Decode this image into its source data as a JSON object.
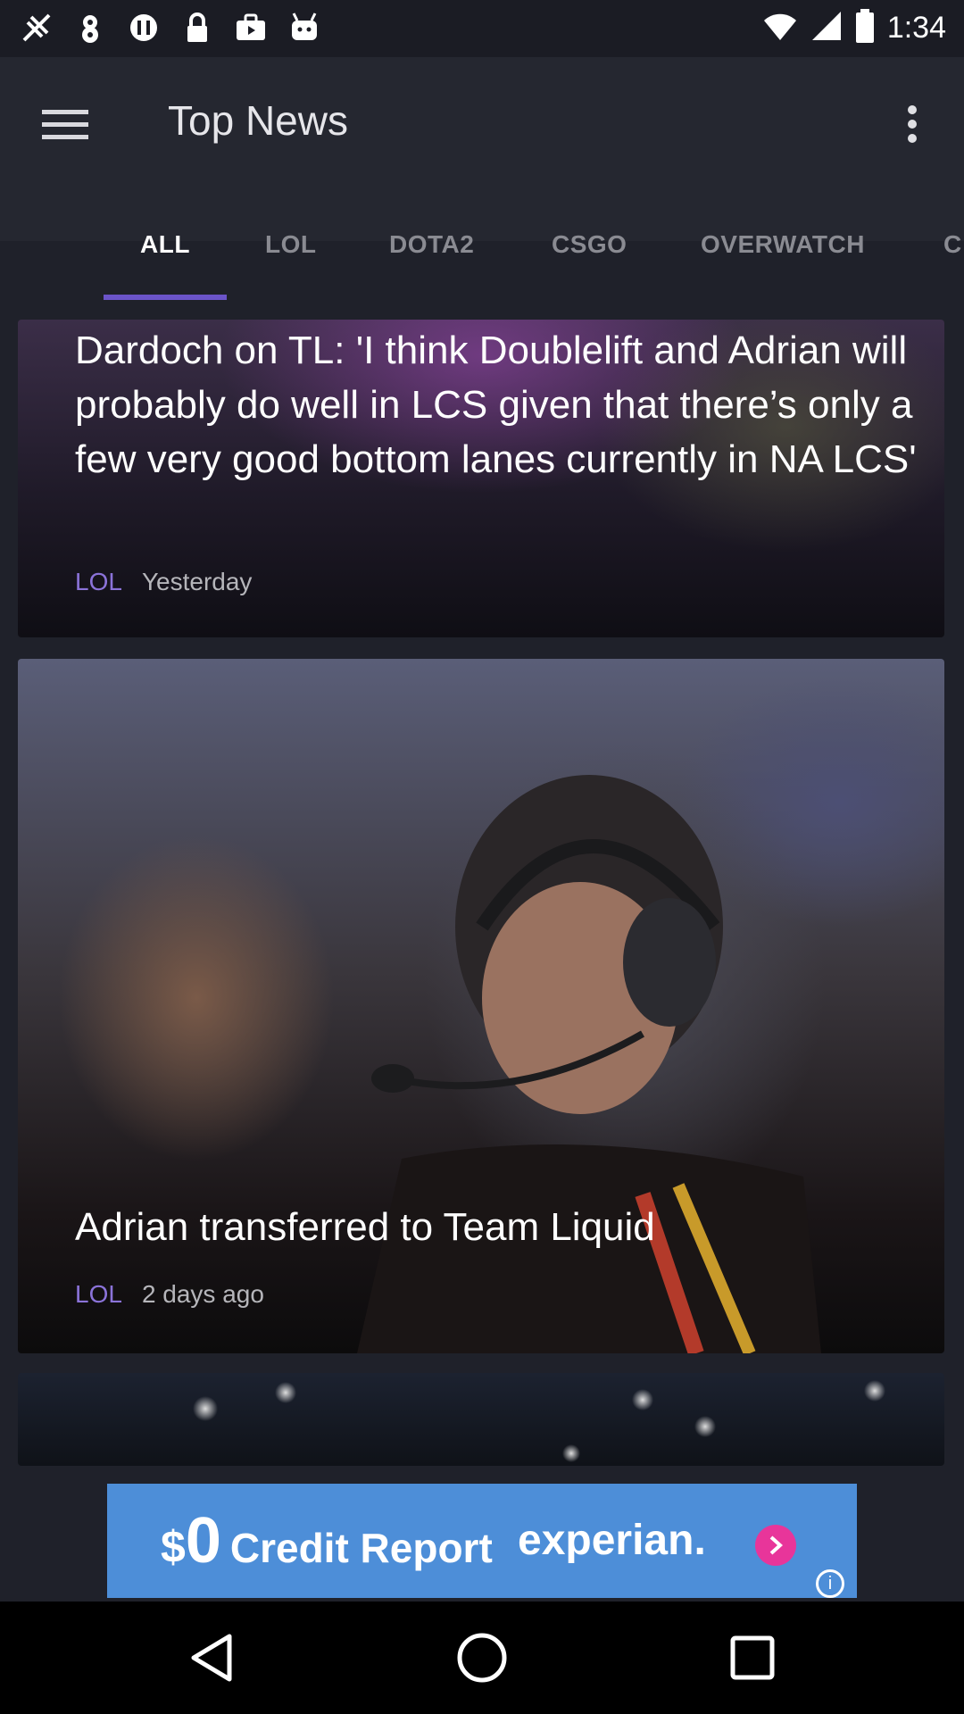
{
  "status_bar": {
    "time": "1:34",
    "left_icons": [
      "signal-off-icon",
      "notification-icon",
      "info-icon",
      "lock-icon",
      "briefcase-icon",
      "android-icon"
    ]
  },
  "app_bar": {
    "title": "Top News",
    "menu_icon": "hamburger-menu-icon",
    "more_icon": "more-vertical-icon"
  },
  "tabs": [
    {
      "label": "ALL",
      "active": true
    },
    {
      "label": "LOL",
      "active": false
    },
    {
      "label": "DOTA2",
      "active": false
    },
    {
      "label": "CSGO",
      "active": false
    },
    {
      "label": "OVERWATCH",
      "active": false
    },
    {
      "label": "C",
      "active": false
    }
  ],
  "articles": [
    {
      "title": "Dardoch on TL: 'I think Doublelift and Adrian will probably do well in LCS given that there’s only a few very good bottom lanes currently in NA LCS'",
      "category": "LOL",
      "time": "Yesterday"
    },
    {
      "title": "Adrian transferred to Team Liquid",
      "category": "LOL",
      "time": "2 days ago"
    }
  ],
  "ad": {
    "dollar": "$",
    "zero": "0",
    "text": "Credit Report",
    "brand": "experian.",
    "info": "i"
  },
  "colors": {
    "accent": "#6b54c9",
    "category": "#8b73d9",
    "app_bar": "#252730"
  }
}
